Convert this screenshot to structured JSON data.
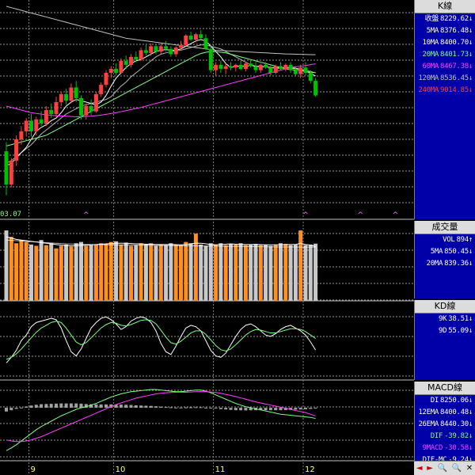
{
  "start_date_label": "03.07",
  "x_axis": {
    "labels": [
      {
        "text": "9",
        "idx": 5
      },
      {
        "text": "10",
        "idx": 22
      },
      {
        "text": "11",
        "idx": 42
      },
      {
        "text": "12",
        "idx": 60
      }
    ]
  },
  "ma_labels": [
    "收盤",
    "5MA",
    "10MA",
    "20MA",
    "60MA",
    "120MA",
    "240MA"
  ],
  "k_panel": {
    "title": "K線",
    "rows": [
      {
        "label": "收盤",
        "value": "8229.62",
        "arrow": "↓",
        "color": "#ffffff"
      },
      {
        "label": "5MA",
        "value": "8376.48",
        "arrow": "↓",
        "color": "#ffffff"
      },
      {
        "label": "10MA",
        "value": "8400.70",
        "arrow": "↓",
        "color": "#ffffff"
      },
      {
        "label": "20MA",
        "value": "8401.73",
        "arrow": "↓",
        "color": "#80ff80"
      },
      {
        "label": "60MA",
        "value": "8467.38",
        "arrow": "↓",
        "color": "#ff40ff"
      },
      {
        "label": "120MA",
        "value": "8536.45",
        "arrow": "↓",
        "color": "#c0c0c0"
      },
      {
        "label": "240MA",
        "value": "9014.85",
        "arrow": "↓",
        "color": "#ff4040"
      }
    ]
  },
  "vol_panel": {
    "title": "成交量",
    "rows": [
      {
        "label": "VOL",
        "value": "894",
        "arrow": "↑",
        "color": "#ffffff"
      },
      {
        "label": "5MA",
        "value": "850.45",
        "arrow": "↓",
        "color": "#ffffff"
      },
      {
        "label": "20MA",
        "value": "839.36",
        "arrow": "↓",
        "color": "#ffffff"
      }
    ]
  },
  "kd_panel": {
    "title": "KD線",
    "rows": [
      {
        "label": "9K",
        "value": "38.51",
        "arrow": "↓",
        "color": "#ffffff"
      },
      {
        "label": "9D",
        "value": "55.09",
        "arrow": "↓",
        "color": "#ffffff"
      }
    ]
  },
  "macd_panel": {
    "title": "MACD線",
    "rows": [
      {
        "label": "DI",
        "value": "8250.06",
        "arrow": "↓",
        "color": "#ffffff"
      },
      {
        "label": "12EMA",
        "value": "8400.48",
        "arrow": "↓",
        "color": "#ffffff"
      },
      {
        "label": "26EMA",
        "value": "8440.30",
        "arrow": "↓",
        "color": "#ffffff"
      },
      {
        "label": "DIF",
        "value": "-39.82",
        "arrow": "↓",
        "color": "#80ff80"
      },
      {
        "label": "9MACD",
        "value": "-30.58",
        "arrow": "↓",
        "color": "#ff40ff"
      },
      {
        "label": "DIF-MC",
        "value": "-9.24",
        "arrow": "↓",
        "color": "#ffffff"
      }
    ]
  },
  "nav": {
    "left": "◄",
    "right": "►",
    "zoom_out": "🔍",
    "zoom_in": "🔍",
    "exit": "✕"
  },
  "colors": {
    "up": "#ff4040",
    "down": "#00c000",
    "grid": "#9a9a9a",
    "vol_up": "#ff9020",
    "vol_down": "#c8c8c8"
  },
  "chart_data": {
    "type": "candlestick",
    "ohlc": [
      [
        7810,
        7880,
        7480,
        7560
      ],
      [
        7560,
        7760,
        7540,
        7740
      ],
      [
        7740,
        7930,
        7700,
        7900
      ],
      [
        7900,
        8000,
        7860,
        7960
      ],
      [
        7960,
        8060,
        7920,
        8040
      ],
      [
        8040,
        8090,
        7920,
        7960
      ],
      [
        7960,
        8070,
        7930,
        8050
      ],
      [
        8050,
        8110,
        8000,
        8020
      ],
      [
        8020,
        8150,
        8000,
        8120
      ],
      [
        8120,
        8170,
        8060,
        8090
      ],
      [
        8090,
        8220,
        8070,
        8180
      ],
      [
        8180,
        8260,
        8150,
        8240
      ],
      [
        8240,
        8280,
        8160,
        8190
      ],
      [
        8190,
        8320,
        8170,
        8290
      ],
      [
        8290,
        8340,
        8180,
        8210
      ],
      [
        8210,
        8230,
        8050,
        8080
      ],
      [
        8080,
        8170,
        8050,
        8150
      ],
      [
        8150,
        8200,
        8080,
        8110
      ],
      [
        8110,
        8260,
        8100,
        8240
      ],
      [
        8240,
        8330,
        8220,
        8310
      ],
      [
        8310,
        8420,
        8290,
        8400
      ],
      [
        8400,
        8450,
        8360,
        8430
      ],
      [
        8430,
        8470,
        8380,
        8400
      ],
      [
        8400,
        8510,
        8390,
        8490
      ],
      [
        8490,
        8530,
        8430,
        8460
      ],
      [
        8460,
        8540,
        8440,
        8520
      ],
      [
        8520,
        8560,
        8480,
        8500
      ],
      [
        8500,
        8590,
        8490,
        8570
      ],
      [
        8570,
        8610,
        8530,
        8550
      ],
      [
        8550,
        8620,
        8530,
        8600
      ],
      [
        8600,
        8610,
        8540,
        8560
      ],
      [
        8560,
        8620,
        8540,
        8600
      ],
      [
        8600,
        8640,
        8560,
        8580
      ],
      [
        8580,
        8600,
        8520,
        8540
      ],
      [
        8540,
        8600,
        8520,
        8590
      ],
      [
        8590,
        8640,
        8570,
        8610
      ],
      [
        8610,
        8690,
        8600,
        8680
      ],
      [
        8680,
        8710,
        8640,
        8650
      ],
      [
        8650,
        8700,
        8630,
        8690
      ],
      [
        8690,
        8720,
        8650,
        8660
      ],
      [
        8660,
        8690,
        8570,
        8580
      ],
      [
        8580,
        8610,
        8400,
        8420
      ],
      [
        8420,
        8480,
        8380,
        8460
      ],
      [
        8460,
        8490,
        8400,
        8430
      ],
      [
        8430,
        8470,
        8390,
        8450
      ],
      [
        8450,
        8480,
        8420,
        8440
      ],
      [
        8440,
        8470,
        8410,
        8460
      ],
      [
        8460,
        8490,
        8420,
        8430
      ],
      [
        8430,
        8480,
        8410,
        8470
      ],
      [
        8470,
        8500,
        8440,
        8450
      ],
      [
        8450,
        8480,
        8400,
        8420
      ],
      [
        8420,
        8470,
        8400,
        8460
      ],
      [
        8460,
        8480,
        8430,
        8440
      ],
      [
        8440,
        8460,
        8380,
        8400
      ],
      [
        8400,
        8460,
        8390,
        8450
      ],
      [
        8450,
        8480,
        8420,
        8430
      ],
      [
        8430,
        8470,
        8410,
        8460
      ],
      [
        8460,
        8480,
        8400,
        8420
      ],
      [
        8420,
        8450,
        8380,
        8390
      ],
      [
        8390,
        8460,
        8360,
        8440
      ],
      [
        8440,
        8480,
        8380,
        8400
      ],
      [
        8400,
        8420,
        8320,
        8340
      ],
      [
        8340,
        8360,
        8220,
        8229.62
      ]
    ],
    "volume": [
      1100,
      1000,
      900,
      950,
      920,
      880,
      860,
      950,
      870,
      900,
      820,
      860,
      880,
      850,
      900,
      920,
      860,
      870,
      880,
      900,
      890,
      920,
      930,
      880,
      910,
      860,
      870,
      900,
      880,
      900,
      860,
      880,
      870,
      900,
      880,
      870,
      920,
      900,
      1050,
      880,
      860,
      900,
      880,
      900,
      870,
      890,
      880,
      900,
      870,
      880,
      890,
      870,
      880,
      860,
      880,
      900,
      890,
      870,
      880,
      1100,
      870,
      880,
      894
    ],
    "kd_k": [
      20,
      28,
      38,
      52,
      60,
      72,
      78,
      80,
      82,
      84,
      82,
      70,
      52,
      36,
      30,
      40,
      55,
      70,
      78,
      84,
      86,
      82,
      76,
      68,
      72,
      80,
      84,
      86,
      84,
      78,
      66,
      48,
      36,
      32,
      44,
      58,
      70,
      74,
      72,
      66,
      52,
      38,
      30,
      28,
      34,
      46,
      58,
      68,
      74,
      76,
      72,
      66,
      60,
      58,
      62,
      68,
      72,
      74,
      70,
      66,
      60,
      50,
      38.51
    ],
    "kd_d": [
      25,
      28,
      33,
      40,
      48,
      56,
      64,
      70,
      74,
      78,
      80,
      78,
      70,
      60,
      50,
      46,
      49,
      56,
      63,
      70,
      75,
      78,
      77,
      74,
      73,
      75,
      78,
      81,
      82,
      81,
      76,
      67,
      57,
      49,
      47,
      51,
      57,
      63,
      66,
      66,
      61,
      53,
      45,
      39,
      37,
      40,
      46,
      53,
      60,
      65,
      68,
      67,
      65,
      63,
      63,
      65,
      67,
      69,
      69,
      68,
      65,
      60,
      55.09
    ],
    "dif": [
      -160,
      -150,
      -138,
      -124,
      -110,
      -96,
      -82,
      -70,
      -60,
      -50,
      -40,
      -30,
      -22,
      -14,
      -6,
      0,
      4,
      10,
      16,
      24,
      32,
      40,
      46,
      52,
      56,
      60,
      62,
      64,
      66,
      68,
      68,
      66,
      64,
      62,
      60,
      60,
      62,
      64,
      66,
      66,
      62,
      56,
      48,
      40,
      32,
      24,
      16,
      10,
      4,
      0,
      -4,
      -8,
      -12,
      -16,
      -20,
      -24,
      -26,
      -28,
      -30,
      -32,
      -34,
      -36,
      -39.82
    ],
    "macd": [
      -120,
      -124,
      -126,
      -126,
      -124,
      -120,
      -114,
      -108,
      -100,
      -92,
      -84,
      -76,
      -68,
      -60,
      -52,
      -44,
      -36,
      -28,
      -20,
      -12,
      -4,
      4,
      12,
      18,
      24,
      30,
      36,
      40,
      44,
      48,
      52,
      54,
      56,
      57,
      58,
      58,
      58,
      59,
      60,
      60,
      60,
      59,
      57,
      54,
      50,
      46,
      42,
      37,
      32,
      27,
      22,
      18,
      14,
      10,
      6,
      2,
      -2,
      -6,
      -10,
      -14,
      -18,
      -24,
      -30.58
    ],
    "ma": {
      "5MA": [
        7700,
        7720,
        7760,
        7800,
        7840,
        7900,
        7960,
        7990,
        8010,
        8040,
        8060,
        8100,
        8150,
        8180,
        8200,
        8190,
        8180,
        8170,
        8160,
        8180,
        8230,
        8300,
        8360,
        8400,
        8440,
        8470,
        8490,
        8500,
        8520,
        8540,
        8560,
        8570,
        8575,
        8570,
        8570,
        8580,
        8600,
        8620,
        8640,
        8650,
        8640,
        8600,
        8560,
        8520,
        8470,
        8440,
        8450,
        8450,
        8450,
        8455,
        8450,
        8445,
        8445,
        8440,
        8435,
        8435,
        8440,
        8440,
        8435,
        8425,
        8415,
        8395,
        8376.48
      ],
      "10MA": [
        7720,
        7740,
        7770,
        7800,
        7830,
        7860,
        7900,
        7940,
        7970,
        8000,
        8030,
        8060,
        8090,
        8110,
        8130,
        8150,
        8160,
        8170,
        8180,
        8190,
        8200,
        8220,
        8260,
        8300,
        8330,
        8370,
        8400,
        8430,
        8460,
        8490,
        8520,
        8540,
        8550,
        8560,
        8565,
        8570,
        8580,
        8590,
        8600,
        8610,
        8610,
        8600,
        8590,
        8580,
        8560,
        8540,
        8520,
        8500,
        8480,
        8460,
        8450,
        8450,
        8445,
        8440,
        8440,
        8440,
        8440,
        8435,
        8430,
        8425,
        8420,
        8410,
        8400.7
      ],
      "20MA": [
        7850,
        7860,
        7870,
        7880,
        7890,
        7900,
        7910,
        7920,
        7930,
        7950,
        7970,
        7990,
        8010,
        8030,
        8050,
        8070,
        8090,
        8110,
        8130,
        8150,
        8170,
        8190,
        8210,
        8230,
        8250,
        8270,
        8290,
        8310,
        8330,
        8350,
        8370,
        8390,
        8410,
        8430,
        8450,
        8470,
        8490,
        8510,
        8530,
        8545,
        8555,
        8560,
        8560,
        8555,
        8550,
        8540,
        8530,
        8520,
        8510,
        8500,
        8490,
        8480,
        8470,
        8460,
        8450,
        8440,
        8430,
        8425,
        8420,
        8415,
        8410,
        8405,
        8401.73
      ],
      "60MA": [
        8150,
        8140,
        8130,
        8120,
        8110,
        8100,
        8095,
        8090,
        8085,
        8080,
        8078,
        8076,
        8074,
        8072,
        8070,
        8070,
        8072,
        8074,
        8078,
        8082,
        8088,
        8094,
        8100,
        8108,
        8116,
        8124,
        8132,
        8140,
        8150,
        8160,
        8170,
        8180,
        8190,
        8200,
        8210,
        8220,
        8230,
        8240,
        8250,
        8260,
        8270,
        8280,
        8290,
        8300,
        8310,
        8320,
        8330,
        8340,
        8350,
        8360,
        8370,
        8380,
        8390,
        8400,
        8410,
        8420,
        8430,
        8440,
        8445,
        8450,
        8455,
        8462,
        8467.38
      ],
      "120MA": [
        8900,
        8890,
        8880,
        8870,
        8860,
        8850,
        8840,
        8830,
        8820,
        8810,
        8800,
        8790,
        8780,
        8770,
        8760,
        8750,
        8740,
        8730,
        8720,
        8710,
        8700,
        8690,
        8680,
        8670,
        8660,
        8655,
        8650,
        8645,
        8640,
        8635,
        8630,
        8625,
        8620,
        8615,
        8610,
        8605,
        8600,
        8595,
        8590,
        8585,
        8580,
        8575,
        8570,
        8568,
        8566,
        8564,
        8562,
        8560,
        8558,
        8556,
        8554,
        8552,
        8550,
        8548,
        8546,
        8544,
        8542,
        8541,
        8540,
        8539,
        8538,
        8537,
        8536.45
      ],
      "240MA": [
        9300,
        9295,
        9290,
        9285,
        9280,
        9275,
        9270,
        9265,
        9260,
        9255,
        9250,
        9245,
        9240,
        9235,
        9230,
        9225,
        9220,
        9215,
        9210,
        9205,
        9200,
        9195,
        9190,
        9185,
        9180,
        9175,
        9170,
        9165,
        9160,
        9155,
        9150,
        9145,
        9140,
        9135,
        9130,
        9125,
        9120,
        9115,
        9110,
        9105,
        9100,
        9095,
        9090,
        9085,
        9080,
        9075,
        9070,
        9065,
        9060,
        9055,
        9050,
        9046,
        9042,
        9038,
        9034,
        9030,
        9027,
        9024,
        9021,
        9019,
        9017,
        9016,
        9014.85
      ]
    },
    "vol_ma5": [
      1000,
      980,
      960,
      950,
      940,
      930,
      920,
      910,
      900,
      890,
      880,
      870,
      865,
      860,
      860,
      865,
      870,
      875,
      880,
      885,
      890,
      895,
      900,
      900,
      900,
      895,
      890,
      890,
      885,
      885,
      880,
      880,
      880,
      880,
      878,
      876,
      880,
      890,
      900,
      900,
      890,
      880,
      875,
      880,
      885,
      890,
      885,
      880,
      880,
      880,
      880,
      878,
      876,
      875,
      875,
      876,
      878,
      880,
      880,
      900,
      880,
      870,
      850.45
    ],
    "vol_ma20": [
      950,
      945,
      940,
      935,
      930,
      925,
      920,
      915,
      910,
      905,
      900,
      895,
      890,
      888,
      886,
      884,
      882,
      880,
      879,
      878,
      877,
      876,
      875,
      874,
      873,
      872,
      871,
      870,
      869,
      868,
      867,
      866,
      865,
      864,
      863,
      862,
      861,
      860,
      859,
      858,
      857,
      856,
      855,
      854,
      853,
      852,
      851,
      850,
      849,
      848,
      847,
      846,
      845,
      844,
      843,
      842,
      842,
      841,
      841,
      840,
      840,
      839,
      839.36
    ],
    "ylim_price": [
      7400,
      8900
    ],
    "ylim_vol": [
      0,
      1200
    ],
    "ylim_kd": [
      0,
      100
    ],
    "ylim_macd": [
      -180,
      80
    ],
    "markers": [
      16,
      60,
      71,
      78
    ]
  }
}
